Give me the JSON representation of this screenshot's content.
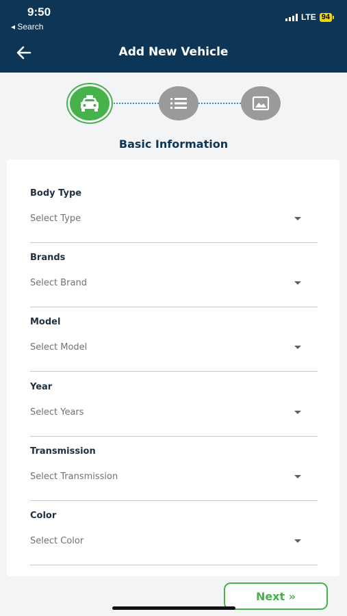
{
  "status_bar": {
    "time": "9:50",
    "back_label": "◂ Search",
    "network": "LTE",
    "battery": "94"
  },
  "header": {
    "title": "Add New Vehicle",
    "back_icon": "arrow-left-icon"
  },
  "stepper": {
    "steps": [
      {
        "icon": "car-icon",
        "active": true
      },
      {
        "icon": "list-icon",
        "active": false
      },
      {
        "icon": "image-icon",
        "active": false
      }
    ],
    "active_color": "#47b24b",
    "inactive_color": "#9a9a9a"
  },
  "section_title": "Basic Information",
  "form": {
    "fields": [
      {
        "label": "Body Type",
        "placeholder": "Select Type"
      },
      {
        "label": "Brands",
        "placeholder": "Select Brand"
      },
      {
        "label": "Model",
        "placeholder": "Select Model"
      },
      {
        "label": "Year",
        "placeholder": "Select Years"
      },
      {
        "label": "Transmission",
        "placeholder": "Select Transmission"
      },
      {
        "label": "Color",
        "placeholder": "Select Color"
      }
    ]
  },
  "next_button": "Next »",
  "colors": {
    "header_bg": "#0d3656",
    "accent": "#47b24b"
  }
}
